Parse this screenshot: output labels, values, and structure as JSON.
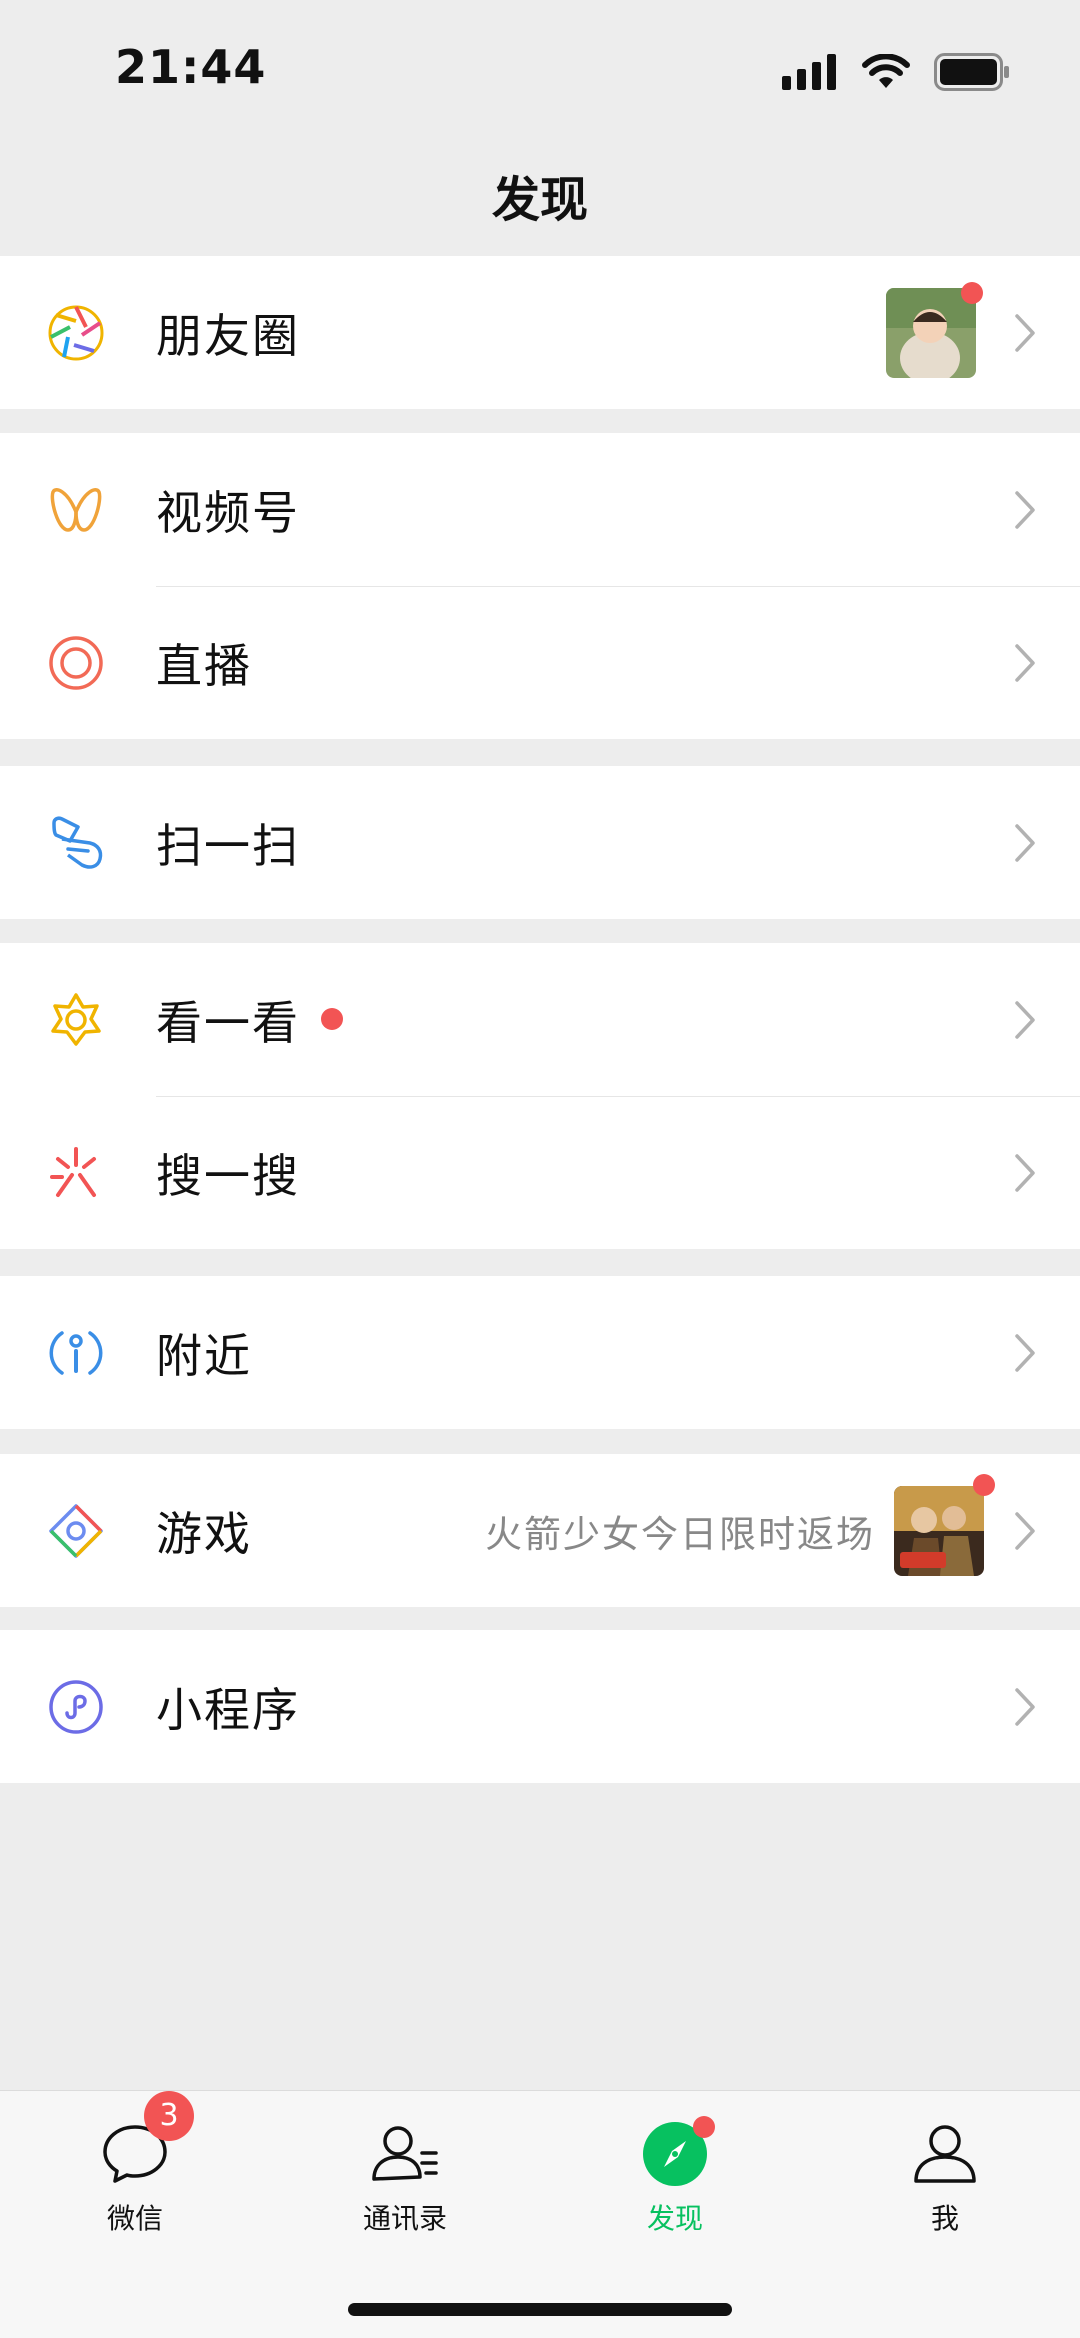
{
  "status_bar": {
    "time": "21:44"
  },
  "nav": {
    "title": "发现"
  },
  "groups": [
    {
      "items": [
        {
          "label": "朋友圈"
        }
      ]
    },
    {
      "items": [
        {
          "label": "视频号"
        },
        {
          "label": "直播"
        }
      ]
    },
    {
      "items": [
        {
          "label": "扫一扫"
        }
      ]
    },
    {
      "items": [
        {
          "label": "看一看"
        },
        {
          "label": "搜一搜"
        }
      ]
    },
    {
      "items": [
        {
          "label": "附近"
        }
      ]
    },
    {
      "items": [
        {
          "label": "游戏",
          "subtitle": "火箭少女今日限时返场"
        }
      ]
    },
    {
      "items": [
        {
          "label": "小程序"
        }
      ]
    }
  ],
  "tabs": [
    {
      "label": "微信",
      "badge": "3"
    },
    {
      "label": "通讯录"
    },
    {
      "label": "发现"
    },
    {
      "label": "我"
    }
  ],
  "colors": {
    "accent": "#07c160",
    "badge_red": "#f25454",
    "background": "#ededed"
  },
  "icons": {
    "moments": "aperture-icon",
    "channels": "butterfly-icon",
    "live": "live-ring-icon",
    "scan": "scan-icon",
    "top_stories": "star-flower-icon",
    "search": "sparkle-search-icon",
    "nearby": "location-person-icon",
    "games": "diamond-games-icon",
    "mini_programs": "mini-program-icon"
  }
}
